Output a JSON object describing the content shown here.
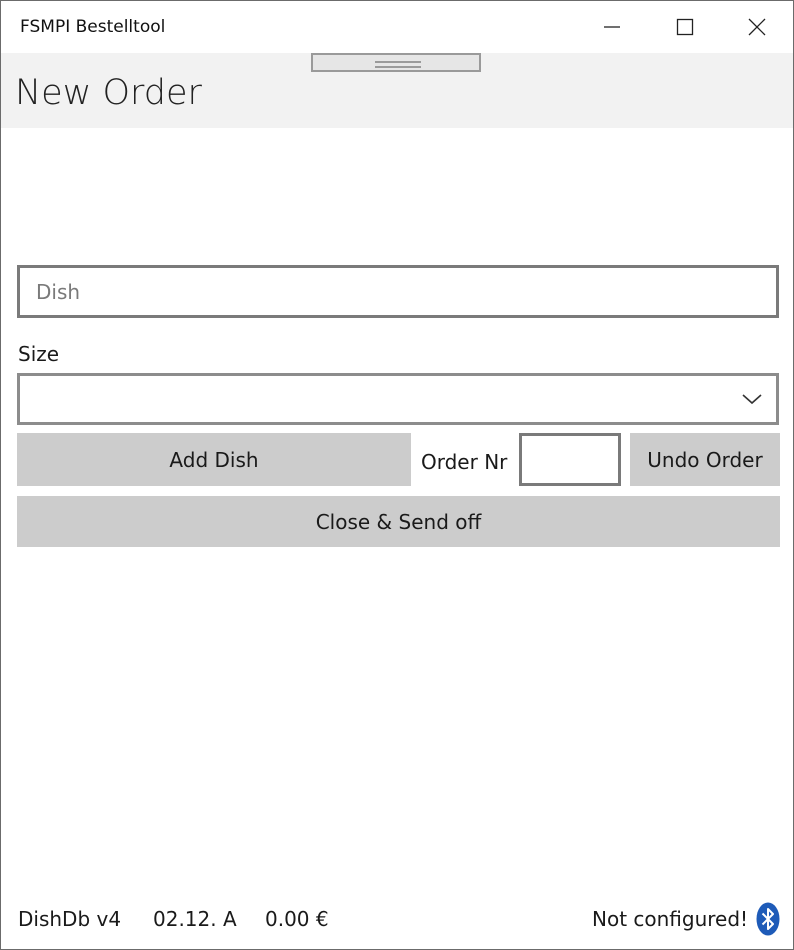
{
  "window": {
    "title": "FSMPI Bestelltool"
  },
  "header": {
    "title": "New Order"
  },
  "form": {
    "dish_placeholder": "Dish",
    "dish_value": "",
    "size_label": "Size",
    "size_value": "",
    "add_dish_label": "Add Dish",
    "order_nr_label": "Order Nr",
    "order_nr_value": "",
    "undo_order_label": "Undo Order",
    "close_send_label": "Close & Send off"
  },
  "status": {
    "db_version": "DishDb v4",
    "date": "02.12. A",
    "total": "0.00 €",
    "config_status": "Not configured!",
    "bluetooth_icon": "bluetooth-icon",
    "bluetooth_color": "#1e5bb8"
  }
}
